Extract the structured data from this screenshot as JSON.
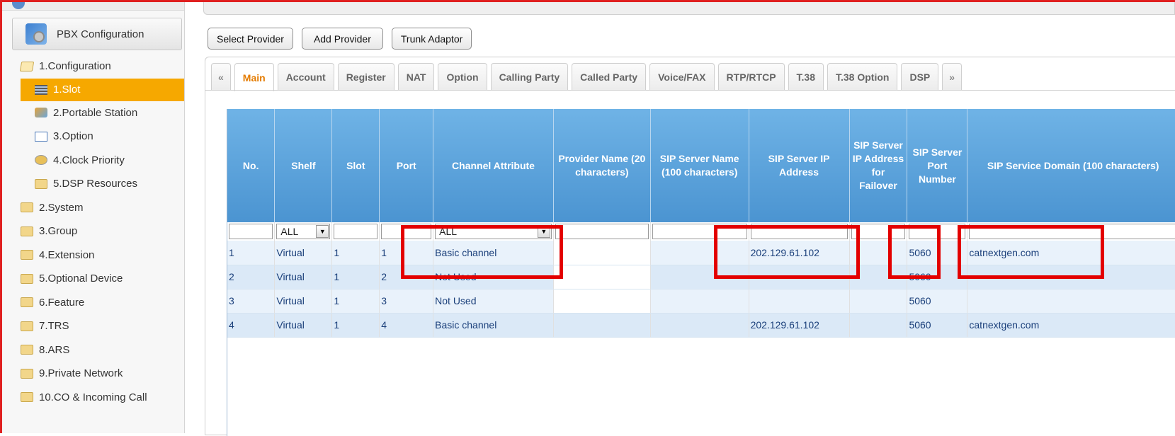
{
  "sidebar": {
    "header": "PBX Configuration",
    "items": [
      {
        "label": "1.Configuration",
        "level": 1,
        "icon": "folder-open-icon"
      },
      {
        "label": "1.Slot",
        "level": 2,
        "icon": "slot-icon",
        "selected": true
      },
      {
        "label": "2.Portable Station",
        "level": 2,
        "icon": "portable-station-icon"
      },
      {
        "label": "3.Option",
        "level": 2,
        "icon": "option-icon"
      },
      {
        "label": "4.Clock Priority",
        "level": 2,
        "icon": "clock-icon"
      },
      {
        "label": "5.DSP Resources",
        "level": 2,
        "icon": "folder-icon"
      },
      {
        "label": "2.System",
        "level": 1,
        "icon": "folder-icon"
      },
      {
        "label": "3.Group",
        "level": 1,
        "icon": "folder-icon"
      },
      {
        "label": "4.Extension",
        "level": 1,
        "icon": "folder-icon"
      },
      {
        "label": "5.Optional Device",
        "level": 1,
        "icon": "folder-icon"
      },
      {
        "label": "6.Feature",
        "level": 1,
        "icon": "folder-icon"
      },
      {
        "label": "7.TRS",
        "level": 1,
        "icon": "folder-icon"
      },
      {
        "label": "8.ARS",
        "level": 1,
        "icon": "folder-icon"
      },
      {
        "label": "9.Private Network",
        "level": 1,
        "icon": "folder-icon"
      },
      {
        "label": "10.CO & Incoming Call",
        "level": 1,
        "icon": "folder-icon"
      }
    ]
  },
  "buttons": {
    "select_provider": "Select Provider",
    "add_provider": "Add Provider",
    "trunk_adaptor": "Trunk Adaptor"
  },
  "tabs": {
    "prev": "«",
    "next": "»",
    "items": [
      "Main",
      "Account",
      "Register",
      "NAT",
      "Option",
      "Calling Party",
      "Called Party",
      "Voice/FAX",
      "RTP/RTCP",
      "T.38",
      "T.38 Option",
      "DSP"
    ],
    "active": "Main"
  },
  "table": {
    "headers": {
      "no": "No.",
      "shelf": "Shelf",
      "slot": "Slot",
      "port": "Port",
      "channel_attribute": "Channel Attribute",
      "provider_name": "Provider Name (20 characters)",
      "sip_server_name": "SIP Server Name (100 characters)",
      "sip_server_ip": "SIP Server IP Address",
      "sip_server_ip_failover": "SIP Server IP Address for Failover",
      "sip_server_port": "SIP Server Port Number",
      "sip_service_domain": "SIP Service Domain (100 characters)"
    },
    "filters": {
      "shelf": "ALL",
      "channel_attribute": "ALL"
    },
    "rows": [
      {
        "no": "1",
        "shelf": "Virtual",
        "slot": "1",
        "port": "1",
        "channel": "Basic channel",
        "provider": "",
        "server_name": "",
        "ip": "202.129.61.102",
        "failover": "",
        "port_number": "5060",
        "domain": "catnextgen.com"
      },
      {
        "no": "2",
        "shelf": "Virtual",
        "slot": "1",
        "port": "2",
        "channel": "Not Used",
        "provider": "",
        "server_name": "",
        "ip": "",
        "failover": "",
        "port_number": "5060",
        "domain": ""
      },
      {
        "no": "3",
        "shelf": "Virtual",
        "slot": "1",
        "port": "3",
        "channel": "Not Used",
        "provider": "",
        "server_name": "",
        "ip": "",
        "failover": "",
        "port_number": "5060",
        "domain": ""
      },
      {
        "no": "4",
        "shelf": "Virtual",
        "slot": "1",
        "port": "4",
        "channel": "Basic channel",
        "provider": "",
        "server_name": "",
        "ip": "202.129.61.102",
        "failover": "",
        "port_number": "5060",
        "domain": "catnextgen.com"
      }
    ]
  },
  "colors": {
    "highlight": "#e30000",
    "selected_item": "#f6a800",
    "active_tab": "#e47b00",
    "header_blue": "#4b94d1"
  }
}
